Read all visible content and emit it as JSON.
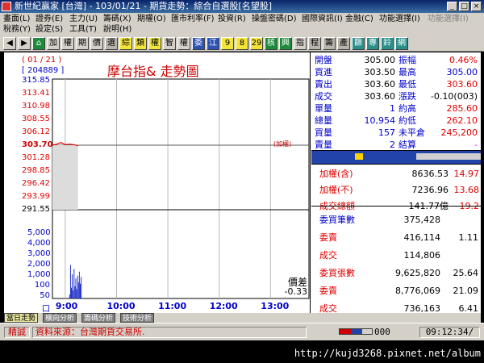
{
  "window": {
    "title": "新世紀贏家 [台灣] - 103/01/21 - 期貨走勢：綜合自選股[名望股]",
    "min": "_",
    "max": "□",
    "close": "×"
  },
  "menu": {
    "row1": [
      "畫面(L)",
      "證券(E)",
      "主力(U)",
      "籌碼(X)",
      "期權(O)",
      "匯市利率(F)",
      "投資(R)",
      "操盤密碼(D)",
      "國際資訊(I)",
      "金融(C)",
      "功能選擇(I)",
      "功能選擇(I)"
    ],
    "row2": [
      "稅務(Y)",
      "設定(S)",
      "工具(T)",
      "說明(H)"
    ]
  },
  "toolbar": {
    "buttons": [
      "加",
      "權",
      "期",
      "價",
      "選",
      "綜",
      "類",
      "權",
      "智",
      "權",
      "委",
      "江",
      "9",
      "8",
      "29",
      "核",
      "興",
      "指",
      "程",
      "籌",
      "產",
      "篩",
      "專",
      "鈴",
      "網"
    ]
  },
  "chart": {
    "date_label": "( 01 / 21 )",
    "code_label": "[ 204889 ]",
    "title": "摩台指& 走勢圖",
    "ref_mark": "(加權)",
    "spread_label": "價差",
    "spread_value": "-0.33",
    "price_ticks": [
      "315.85",
      "313.41",
      "310.98",
      "308.55",
      "306.12",
      "303.70",
      "301.28",
      "298.85",
      "296.42",
      "293.99",
      "291.55"
    ],
    "volume_ticks": [
      "5,000",
      "4,000",
      "3,000",
      "2,000",
      "1,000",
      "100",
      "50",
      "口"
    ],
    "time_ticks": [
      "9:00",
      "10:00",
      "11:00",
      "12:00",
      "13:00"
    ]
  },
  "chart_data": {
    "type": "line",
    "title": "摩台指& 走勢圖",
    "xlabel": "",
    "ylabel": "",
    "x": [
      "8:45",
      "8:50",
      "8:55",
      "9:00",
      "9:05",
      "9:10",
      "9:15"
    ],
    "series": [
      {
        "values": [
          303.7,
          303.9,
          304.2,
          303.8,
          303.9,
          303.8,
          303.6
        ]
      }
    ],
    "volume": [
      0,
      0,
      0,
      0,
      300,
      2500,
      800,
      1800,
      600,
      2200,
      900,
      1500,
      700,
      1700,
      1200,
      2000,
      1100,
      1600
    ],
    "ylim": [
      291.55,
      315.85
    ],
    "xlim": [
      "8:45",
      "13:45"
    ],
    "reference_price": 303.7
  },
  "quote": {
    "rows": [
      {
        "l1": "開盤",
        "v1": "305.00",
        "l2": "振幅",
        "v2": "0.46%"
      },
      {
        "l1": "買進",
        "v1": "303.50",
        "l2": "最高",
        "v2": "305.00"
      },
      {
        "l1": "賣出",
        "v1": "303.60",
        "l2": "最低",
        "v2": "303.60"
      },
      {
        "l1": "成交",
        "v1": "303.60",
        "l2": "漲跌",
        "v2": "-0.10(003)"
      },
      {
        "l1": "單量",
        "v1": "1",
        "l2": "約高",
        "v2": "285.60"
      },
      {
        "l1": "總量",
        "v1": "10,954",
        "l2": "約低",
        "v2": "262.10"
      },
      {
        "l1": "買量",
        "v1": "157",
        "l2": "未平倉",
        "v2": "245,200"
      },
      {
        "l1": "賣量",
        "v1": "2",
        "l2": "結算",
        "v2": "-"
      }
    ]
  },
  "index": {
    "rows": [
      {
        "label": "加權(含)",
        "value": "8636.53",
        "change": "14.97"
      },
      {
        "label": "加權(不)",
        "value": "7236.96",
        "change": "13.68"
      },
      {
        "label": "成交總額",
        "value": "141.77億",
        "change": "19.2"
      }
    ]
  },
  "orders": {
    "rows": [
      {
        "label": "委買筆數",
        "value": "375,428",
        "extra": ""
      },
      {
        "label": "委賣",
        "value": "416,114",
        "extra": "1.11"
      },
      {
        "label": "成交",
        "value": "114,806",
        "extra": ""
      },
      {
        "label": "委買張數",
        "value": "9,625,820",
        "extra": "25.64"
      },
      {
        "label": "委賣",
        "value": "8,776,069",
        "extra": "21.09"
      },
      {
        "label": "成交",
        "value": "736,163",
        "extra": "6.41"
      }
    ]
  },
  "tabs": [
    "當日走勢",
    "橫向分析",
    "籌碼分析",
    "技術分析"
  ],
  "status": {
    "mode": "精誠",
    "message": "資料來源：台灣期貨交易所.",
    "count": "000",
    "time": "09:12:34/"
  },
  "footer": {
    "watermark": "http://kujd3268.pixnet.net/album"
  }
}
